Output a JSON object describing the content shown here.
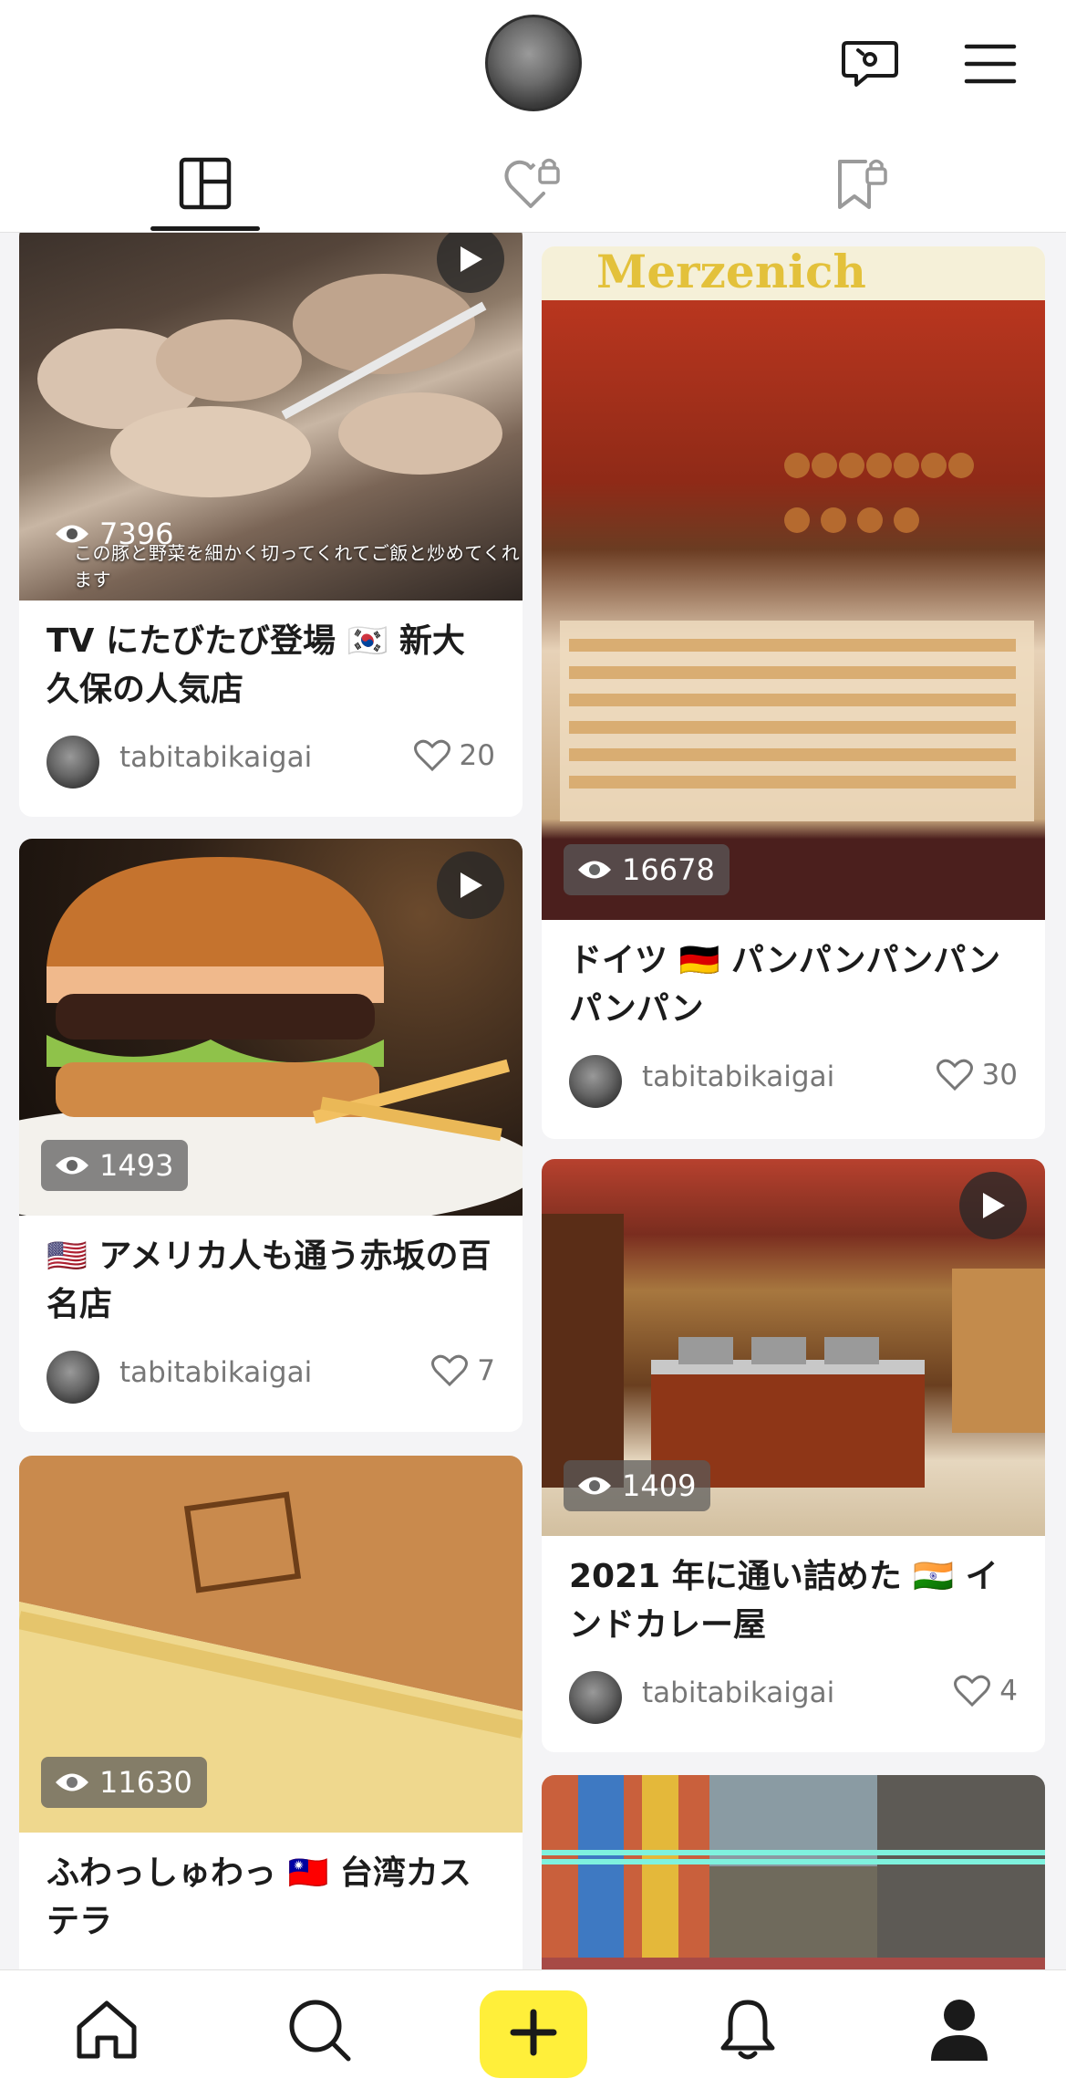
{
  "header": {
    "avatar_icon": "profile-avatar",
    "icons": [
      "coupon-chat-icon",
      "menu-icon"
    ]
  },
  "tabs": [
    {
      "icon": "grid-icon",
      "active": true
    },
    {
      "icon": "liked-locked-icon",
      "active": false
    },
    {
      "icon": "saved-locked-icon",
      "active": false
    }
  ],
  "cards_left": [
    {
      "views": "7396",
      "caption": "この豚と野菜を細かく切ってくれてご飯と炒めてくれます",
      "title": "TV にたびたび登場 🇰🇷 新大久保の人気店",
      "author": "tabitabikaigai",
      "likes": "20",
      "video": true
    },
    {
      "views": "1493",
      "title": "🇺🇸 アメリカ人も通う赤坂の百名店",
      "author": "tabitabikaigai",
      "likes": "7",
      "video": true
    },
    {
      "views": "11630",
      "title": "ふわっしゅわっ 🇹🇼 台湾カステラ",
      "author": "",
      "likes": "",
      "video": false
    }
  ],
  "cards_right": [
    {
      "views": "16678",
      "title": "ドイツ 🇩🇪 パンパンパンパンパンパン",
      "author": "tabitabikaigai",
      "likes": "30",
      "video": false
    },
    {
      "views": "1409",
      "title": "2021 年に通い詰めた 🇮🇳 インドカレー屋",
      "author": "tabitabikaigai",
      "likes": "4",
      "video": true
    }
  ],
  "bottom_nav": [
    {
      "icon": "home-icon"
    },
    {
      "icon": "search-icon"
    },
    {
      "icon": "plus-icon",
      "accent": "#ffef3a"
    },
    {
      "icon": "bell-icon"
    },
    {
      "icon": "profile-icon"
    }
  ],
  "colors": {
    "accent": "#ffef3a",
    "background": "#f4f4f6",
    "text": "#1c1c1c",
    "muted": "#777777"
  }
}
